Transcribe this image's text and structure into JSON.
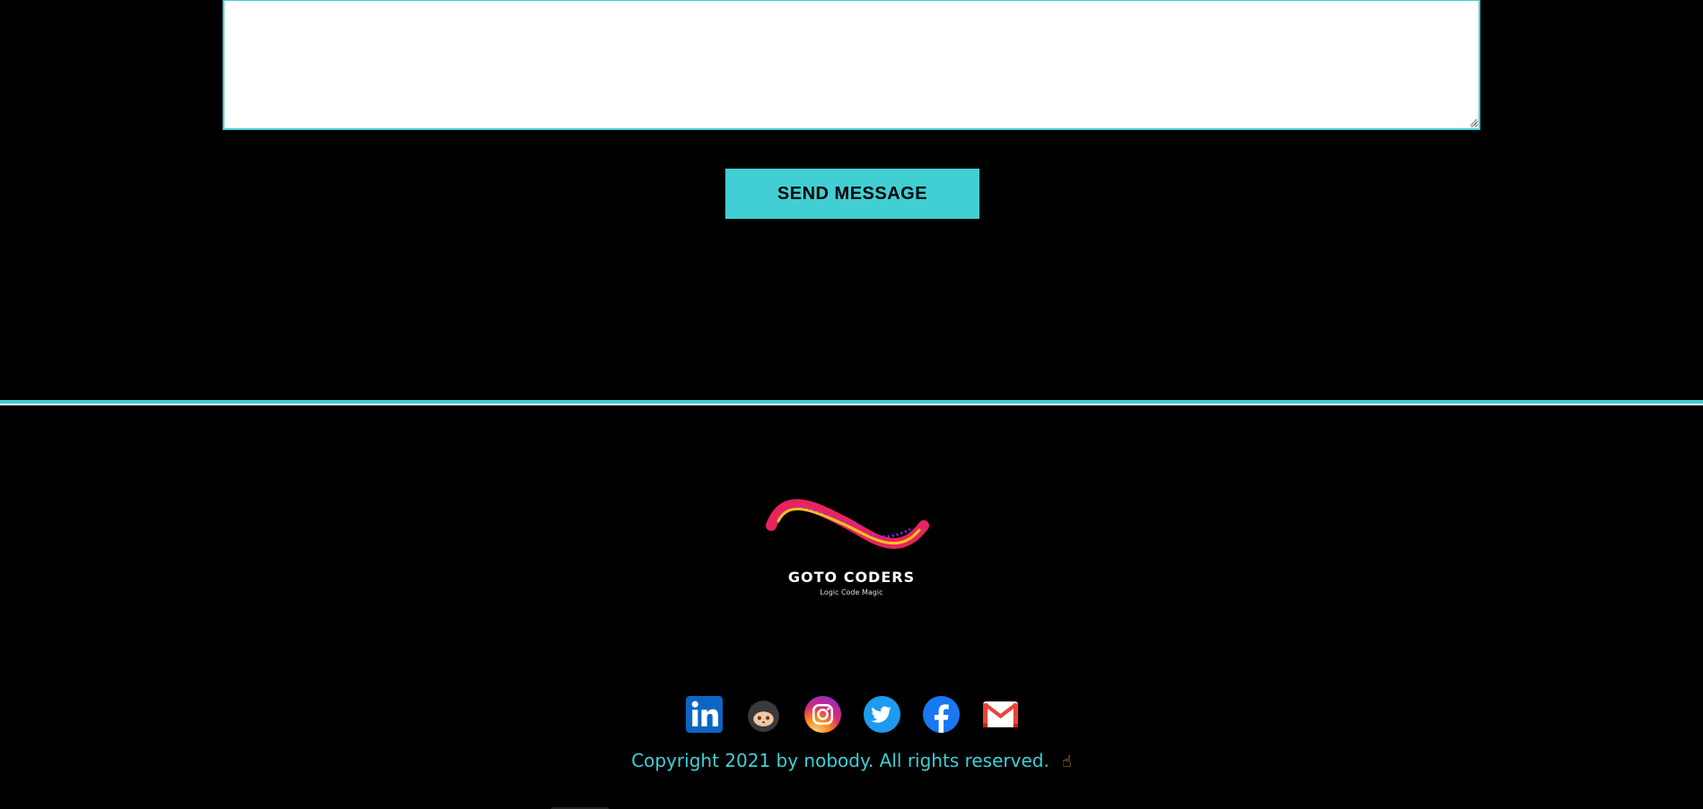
{
  "form": {
    "message_value": "",
    "send_label": "SEND MESSAGE"
  },
  "footer": {
    "logo": {
      "title": "GOTO CODERS",
      "tagline": "Logic Code Magic"
    },
    "socials": [
      {
        "name": "LinkedIn",
        "icon": "linkedin-icon",
        "color": "#0a66c2"
      },
      {
        "name": "GitHub",
        "icon": "github-icon",
        "color": "#3a3a3a"
      },
      {
        "name": "Instagram",
        "icon": "instagram-icon",
        "color": "#d62976"
      },
      {
        "name": "Twitter",
        "icon": "twitter-icon",
        "color": "#1d9bf0"
      },
      {
        "name": "Facebook",
        "icon": "facebook-icon",
        "color": "#1877f2"
      },
      {
        "name": "Gmail",
        "icon": "gmail-icon",
        "color": "#ea4335"
      }
    ],
    "copyright": "Copyright 2021 by nobody. All rights reserved.",
    "copyright_emoji": "☝"
  },
  "colors": {
    "accent": "#41cfd4",
    "background": "#000000"
  }
}
